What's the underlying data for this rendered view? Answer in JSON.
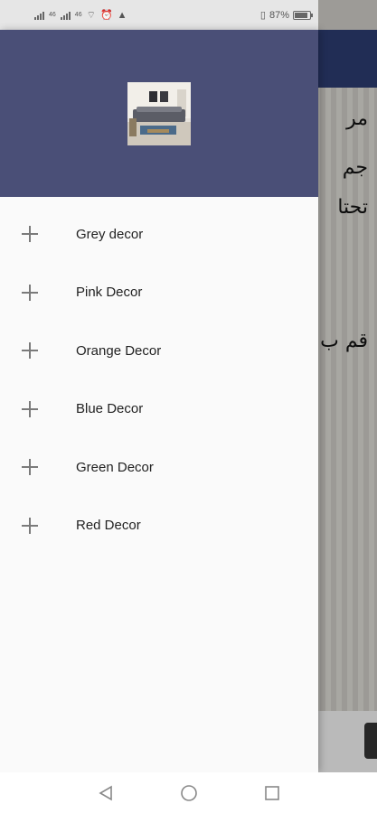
{
  "status_bar": {
    "network_left": "46",
    "network_right": "46",
    "battery_percent": "87%",
    "battery_level": 0.87
  },
  "background": {
    "arabic_line1": "مر",
    "arabic_line2": "جم",
    "arabic_line3": "تحتا",
    "arabic_line4": "قم ب"
  },
  "drawer": {
    "header_image": "living-room-thumbnail",
    "items": [
      {
        "label": "Grey decor",
        "icon": "plus-icon"
      },
      {
        "label": "Pink Decor",
        "icon": "plus-icon"
      },
      {
        "label": "Orange Decor",
        "icon": "plus-icon"
      },
      {
        "label": "Blue Decor",
        "icon": "plus-icon"
      },
      {
        "label": "Green Decor",
        "icon": "plus-icon"
      },
      {
        "label": "Red Decor",
        "icon": "plus-icon"
      }
    ]
  },
  "nav_bar": {
    "back": "back-triangle-icon",
    "home": "home-circle-icon",
    "recents": "recents-square-icon"
  },
  "colors": {
    "drawer_header": "#4a4f77",
    "app_bar": "#2b3a6e",
    "drawer_bg": "#fafafa"
  }
}
